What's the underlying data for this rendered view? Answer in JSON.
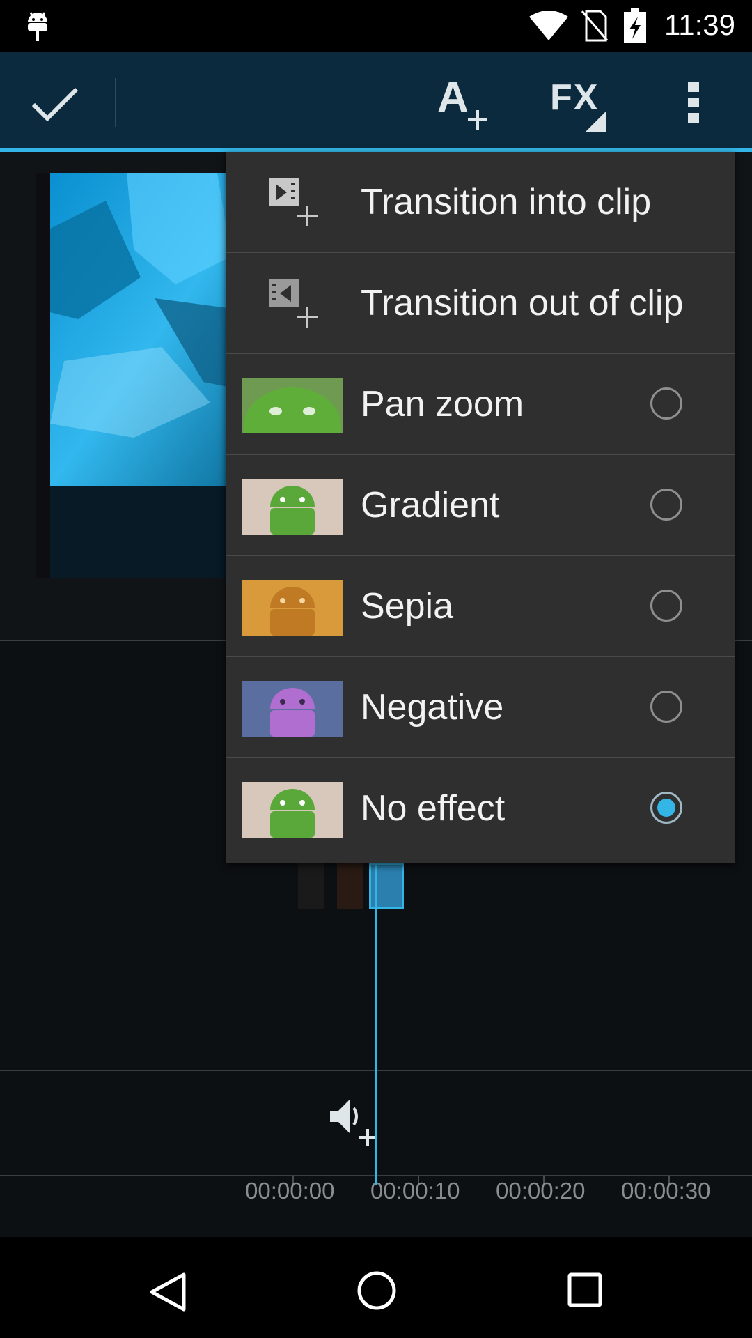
{
  "status_bar": {
    "time": "11:39",
    "icons": [
      "android-debug-icon",
      "wifi-icon",
      "no-sim-icon",
      "battery-charging-icon"
    ]
  },
  "action_bar": {
    "done_icon": "checkmark-icon",
    "add_text_icon": "add-text-icon",
    "fx_label": "FX",
    "overflow_icon": "overflow-menu-icon",
    "accent_color": "#33b5e5",
    "background_color": "#0b2a3d"
  },
  "popup_menu": {
    "items": [
      {
        "label": "Transition into clip",
        "icon": "transition-in-icon"
      },
      {
        "label": "Transition out of clip",
        "icon": "transition-out-icon"
      },
      {
        "label": "Pan zoom",
        "thumb": "pan-zoom-thumbnail",
        "selected": false
      },
      {
        "label": "Gradient",
        "thumb": "gradient-thumbnail",
        "selected": false
      },
      {
        "label": "Sepia",
        "thumb": "sepia-thumbnail",
        "selected": false
      },
      {
        "label": "Negative",
        "thumb": "negative-thumbnail",
        "selected": false
      },
      {
        "label": "No effect",
        "thumb": "no-effect-thumbnail",
        "selected": true
      }
    ]
  },
  "timeline": {
    "audio_add_icon": "add-audio-icon",
    "ruler": [
      "00:00:00",
      "00:00:10",
      "00:00:20",
      "00:00:30"
    ]
  },
  "nav_bar": {
    "icons": [
      "back-icon",
      "home-icon",
      "recents-icon"
    ]
  }
}
